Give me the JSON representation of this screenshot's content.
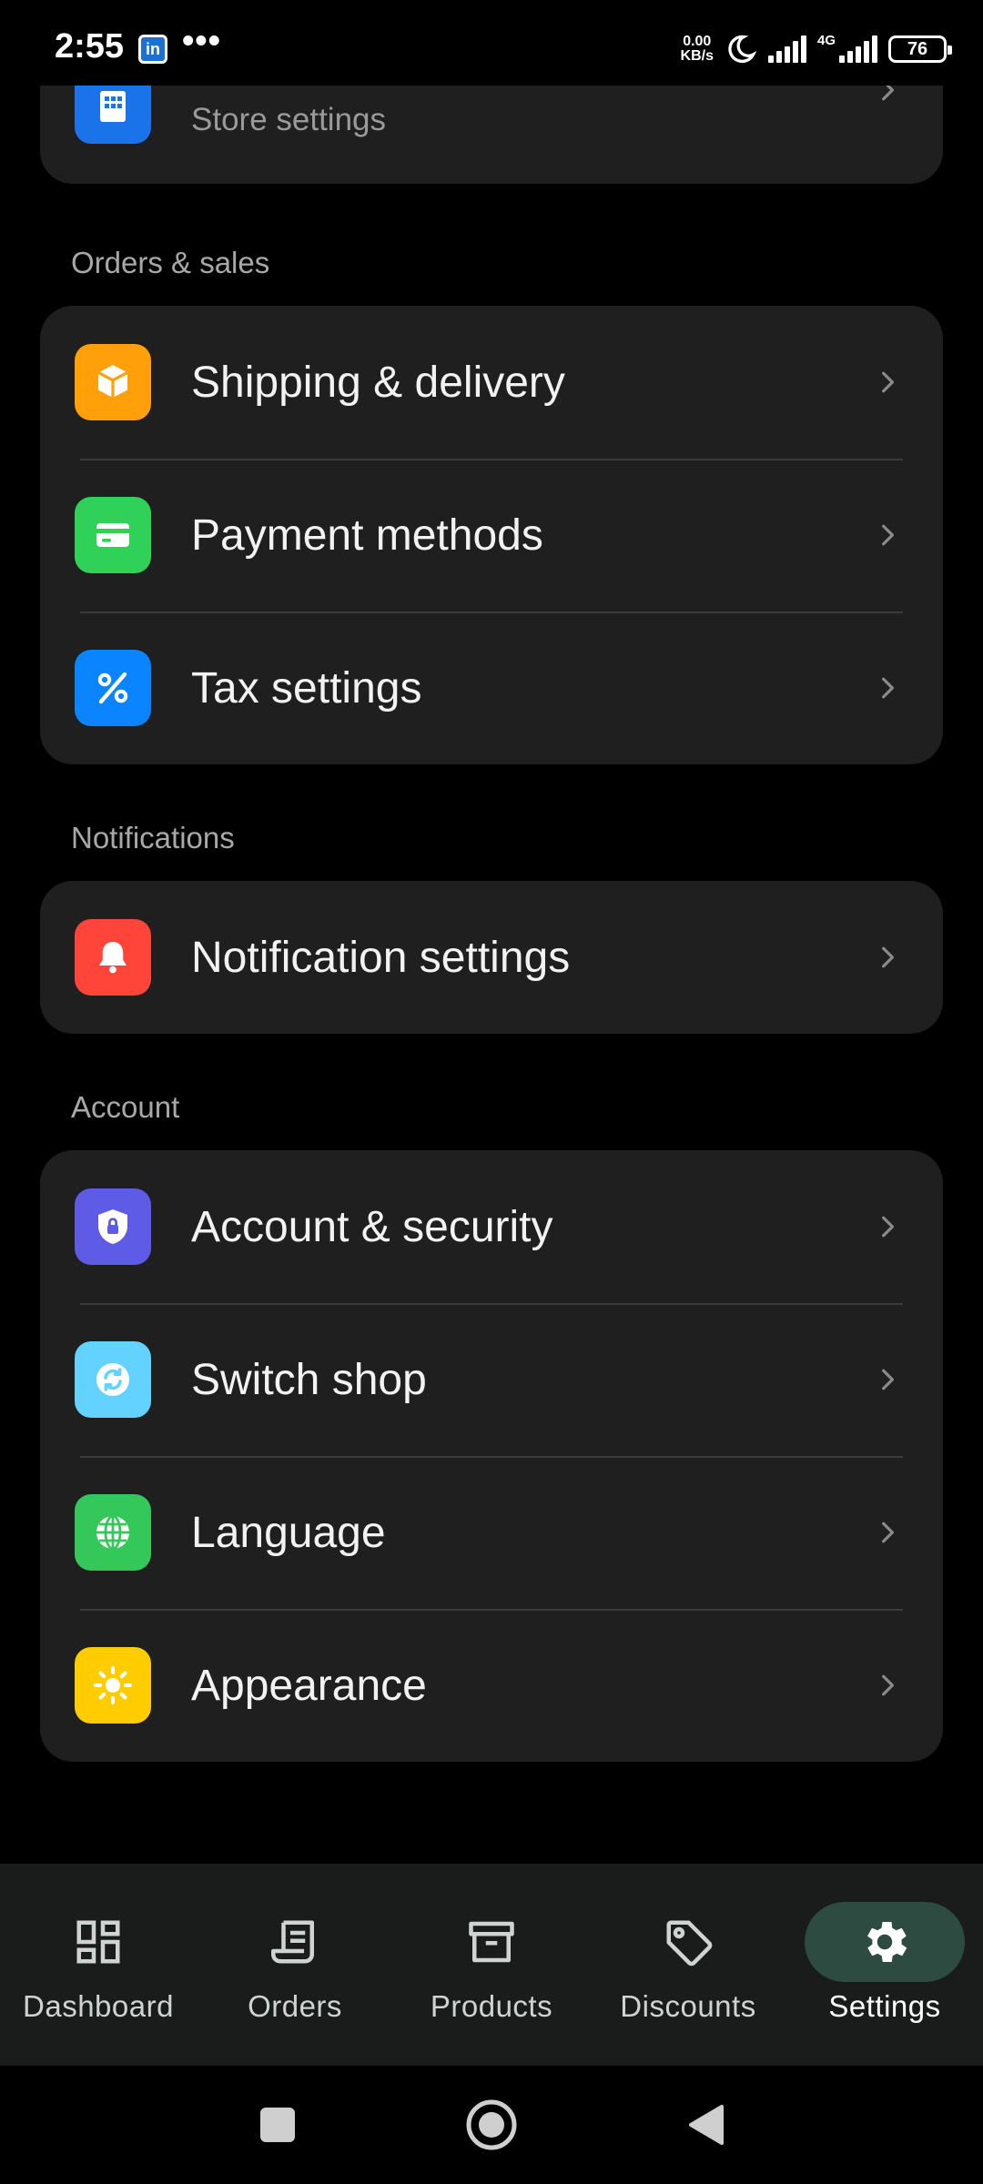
{
  "status_bar": {
    "time": "2:55",
    "app_badge": "in",
    "overflow": "•••",
    "net_speed_value": "0.00",
    "net_speed_unit": "KB/s",
    "network_type": "4G",
    "battery": "76"
  },
  "top_card": {
    "subtitle": "Store settings",
    "icon": "building-icon",
    "icon_color": "#1a73e8"
  },
  "sections": {
    "orders_sales": {
      "title": "Orders & sales",
      "items": [
        {
          "label": "Shipping & delivery",
          "icon": "package-icon",
          "color": "#ff9f0a"
        },
        {
          "label": "Payment methods",
          "icon": "credit-card-icon",
          "color": "#30d158"
        },
        {
          "label": "Tax settings",
          "icon": "percent-icon",
          "color": "#0a84ff"
        }
      ]
    },
    "notifications": {
      "title": "Notifications",
      "items": [
        {
          "label": "Notification settings",
          "icon": "bell-icon",
          "color": "#ff453a"
        }
      ]
    },
    "account": {
      "title": "Account",
      "items": [
        {
          "label": "Account & security",
          "icon": "shield-lock-icon",
          "color": "#5e5ce6"
        },
        {
          "label": "Switch shop",
          "icon": "refresh-icon",
          "color": "#64d2ff"
        },
        {
          "label": "Language",
          "icon": "globe-icon",
          "color": "#34c759"
        },
        {
          "label": "Appearance",
          "icon": "sun-icon",
          "color": "#ffcc00"
        }
      ]
    }
  },
  "bottom_nav": {
    "items": [
      {
        "label": "Dashboard",
        "icon": "dashboard-icon"
      },
      {
        "label": "Orders",
        "icon": "receipt-icon"
      },
      {
        "label": "Products",
        "icon": "archive-box-icon"
      },
      {
        "label": "Discounts",
        "icon": "tag-icon"
      },
      {
        "label": "Settings",
        "icon": "gear-icon",
        "active": true
      }
    ]
  },
  "colors": {
    "background": "#000000",
    "card": "#1f1f1f",
    "nav_bar": "#191c1b",
    "nav_active_pill": "#2d4b40"
  }
}
